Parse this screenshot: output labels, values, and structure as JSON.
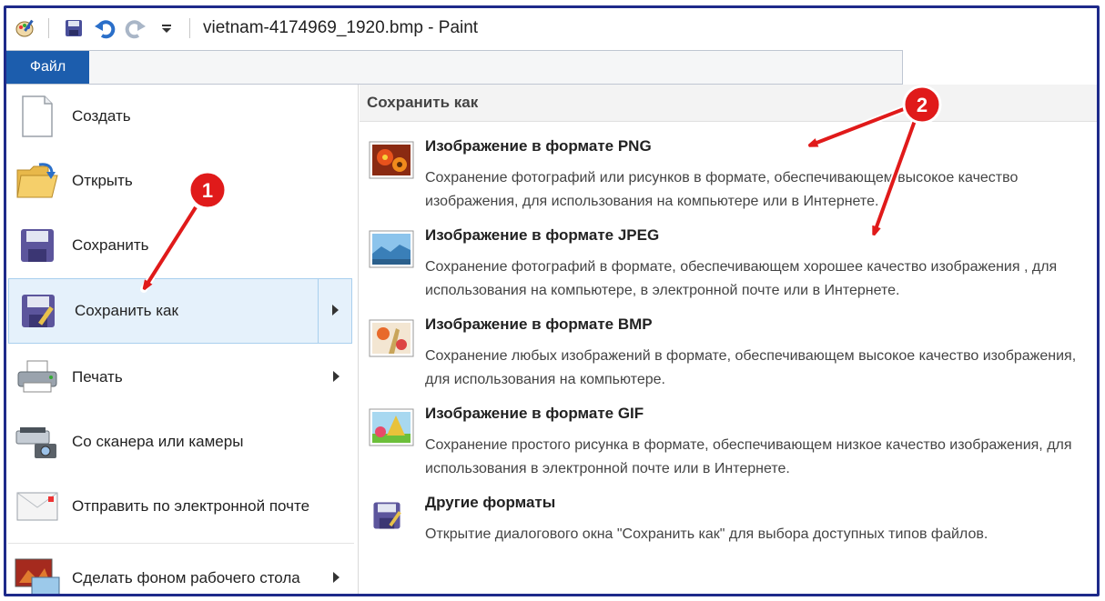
{
  "window": {
    "title": "vietnam-4174969_1920.bmp - Paint"
  },
  "ribbon": {
    "file_tab": "Файл"
  },
  "left_menu": {
    "items": [
      {
        "label": "Создать"
      },
      {
        "label": "Открыть"
      },
      {
        "label": "Сохранить"
      },
      {
        "label": "Сохранить как"
      },
      {
        "label": "Печать"
      },
      {
        "label": "Со сканера или камеры"
      },
      {
        "label": "Отправить по электронной почте"
      },
      {
        "label": "Сделать фоном рабочего стола"
      }
    ]
  },
  "save_as": {
    "header": "Сохранить как",
    "options": [
      {
        "title": "Изображение в формате PNG",
        "desc": "Сохранение фотографий или рисунков в формате, обеспечивающем высокое качество изображения, для использования на компьютере или в Интернете."
      },
      {
        "title": "Изображение в формате JPEG",
        "desc": "Сохранение фотографий в формате, обеспечивающем хорошее качество изображения , для использования на компьютере, в электронной почте или в Интернете."
      },
      {
        "title": "Изображение в формате BMP",
        "desc": "Сохранение любых изображений в формате, обеспечивающем высокое качество изображения, для использования на компьютере."
      },
      {
        "title": "Изображение в формате GIF",
        "desc": "Сохранение простого рисунка в формате, обеспечивающем низкое качество изображения, для использования в электронной почте или в Интернете."
      },
      {
        "title": "Другие форматы",
        "desc": "Открытие диалогового окна \"Сохранить как\" для выбора доступных типов файлов."
      }
    ]
  },
  "annotations": {
    "badge1": "1",
    "badge2": "2"
  },
  "colors": {
    "file_tab": "#1c5dad",
    "frame": "#1e2a8a",
    "highlight": "#e5f1fb",
    "annotation_red": "#e01a1a"
  }
}
